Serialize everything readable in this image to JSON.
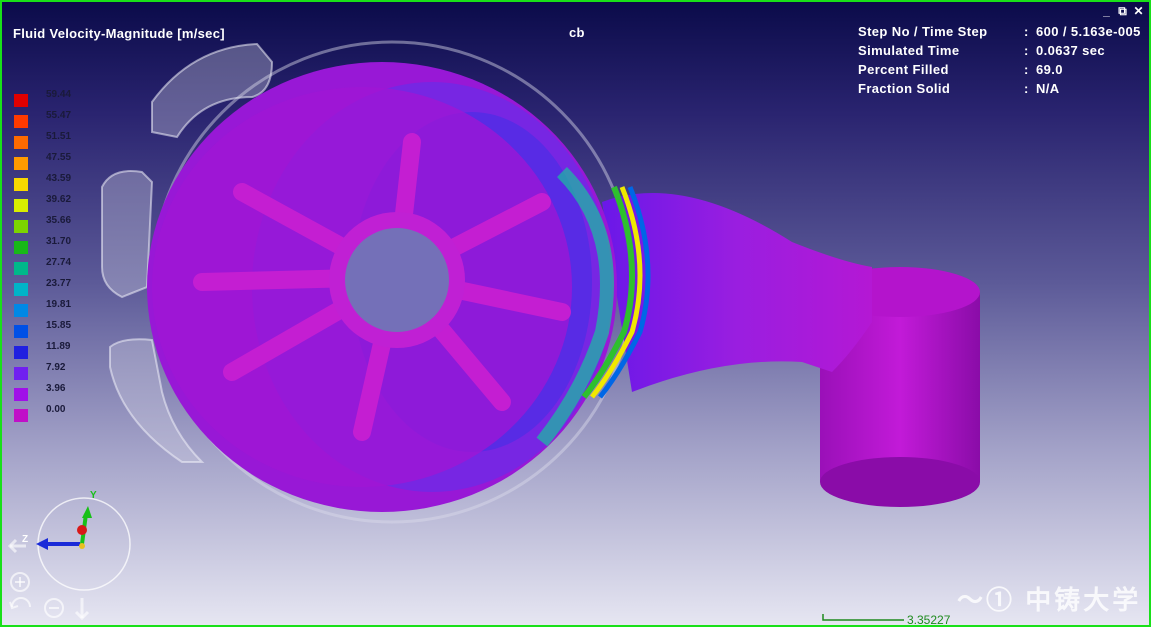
{
  "result_title": "Fluid Velocity-Magnitude [m/sec]",
  "case_name": "cb",
  "info": [
    {
      "label": "Step No / Time Step",
      "value": "600  /  5.163e-005"
    },
    {
      "label": "Simulated Time",
      "value": "0.0637 sec"
    },
    {
      "label": "Percent Filled",
      "value": "69.0"
    },
    {
      "label": "Fraction Solid",
      "value": "N/A"
    }
  ],
  "info_colon": ":",
  "legend": [
    {
      "value": "59.44",
      "color": "#e00000"
    },
    {
      "value": "55.47",
      "color": "#ff3a00"
    },
    {
      "value": "51.51",
      "color": "#ff6a00"
    },
    {
      "value": "47.55",
      "color": "#ff9a00"
    },
    {
      "value": "43.59",
      "color": "#f8d800"
    },
    {
      "value": "39.62",
      "color": "#d8ee00"
    },
    {
      "value": "35.66",
      "color": "#7cd400"
    },
    {
      "value": "31.70",
      "color": "#18b818"
    },
    {
      "value": "27.74",
      "color": "#00b88a"
    },
    {
      "value": "23.77",
      "color": "#00b4c8"
    },
    {
      "value": "19.81",
      "color": "#0088e6"
    },
    {
      "value": "15.85",
      "color": "#0050e6"
    },
    {
      "value": "11.89",
      "color": "#2020e0"
    },
    {
      "value": "7.92",
      "color": "#7020f0"
    },
    {
      "value": "3.96",
      "color": "#a010e8"
    },
    {
      "value": "0.00",
      "color": "#c010c8"
    }
  ],
  "axes": {
    "y": "Y",
    "z": "Z"
  },
  "scale_value": "3.35227",
  "window_controls": {
    "minimize": "_",
    "restore": "⧉",
    "close": "✕"
  },
  "watermark": "〜① 中铸大学",
  "icons": [
    "minimize-icon",
    "restore-icon",
    "close-icon",
    "zoom-in-icon",
    "zoom-out-icon",
    "rotate-icon",
    "arrow-down-icon",
    "arrow-left-icon"
  ]
}
